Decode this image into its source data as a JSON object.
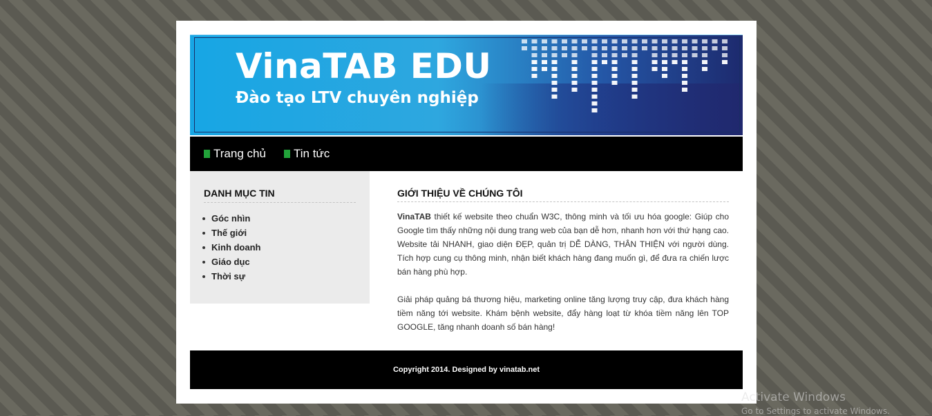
{
  "banner": {
    "title": "VinaTAB EDU",
    "subtitle": "Đào tạo LTV chuyên nghiệp"
  },
  "nav": {
    "items": [
      {
        "label": "Trang chủ"
      },
      {
        "label": "Tin tức"
      }
    ]
  },
  "sidebar": {
    "title": "DANH MỤC TIN",
    "items": [
      {
        "label": "Góc nhìn"
      },
      {
        "label": "Thế giới"
      },
      {
        "label": "Kinh doanh"
      },
      {
        "label": "Giáo dục"
      },
      {
        "label": "Thời sự"
      }
    ]
  },
  "content": {
    "title": "GIỚI THIỆU VỀ CHÚNG TÔI",
    "p1_brand": "VinaTAB",
    "p1_text": " thiết kế website theo chuẩn W3C, thông minh và tối ưu hóa google: Giúp cho Google tìm thấy những nội dung trang web của bạn dễ hơn, nhanh hơn với thứ hạng cao. Website tải NHANH, giao diện ĐẸP, quản trị DỄ DÀNG, THÂN THIỆN với người dùng. Tích hợp cung cụ thông minh, nhận biết khách hàng đang muốn gì, để đưa ra chiến lược bán hàng phù hợp.",
    "p2_text": "Giải pháp quảng bá thương hiệu, marketing online tăng lượng truy cập, đưa khách hàng tiềm năng tới website. Khám bệnh website, đẩy hàng loạt từ khóa tiềm năng lên TOP GOOGLE, tăng nhanh doanh số bán hàng!"
  },
  "footer": {
    "text": "Copyright 2014. Designed by vinatab.net"
  },
  "watermark": {
    "line1": "Activate Windows",
    "line2": "Go to Settings to activate Windows."
  },
  "colors": {
    "nav_marker": "#22a33a",
    "banner_light": "#17a6e4",
    "banner_dark": "#1d2a6e"
  }
}
